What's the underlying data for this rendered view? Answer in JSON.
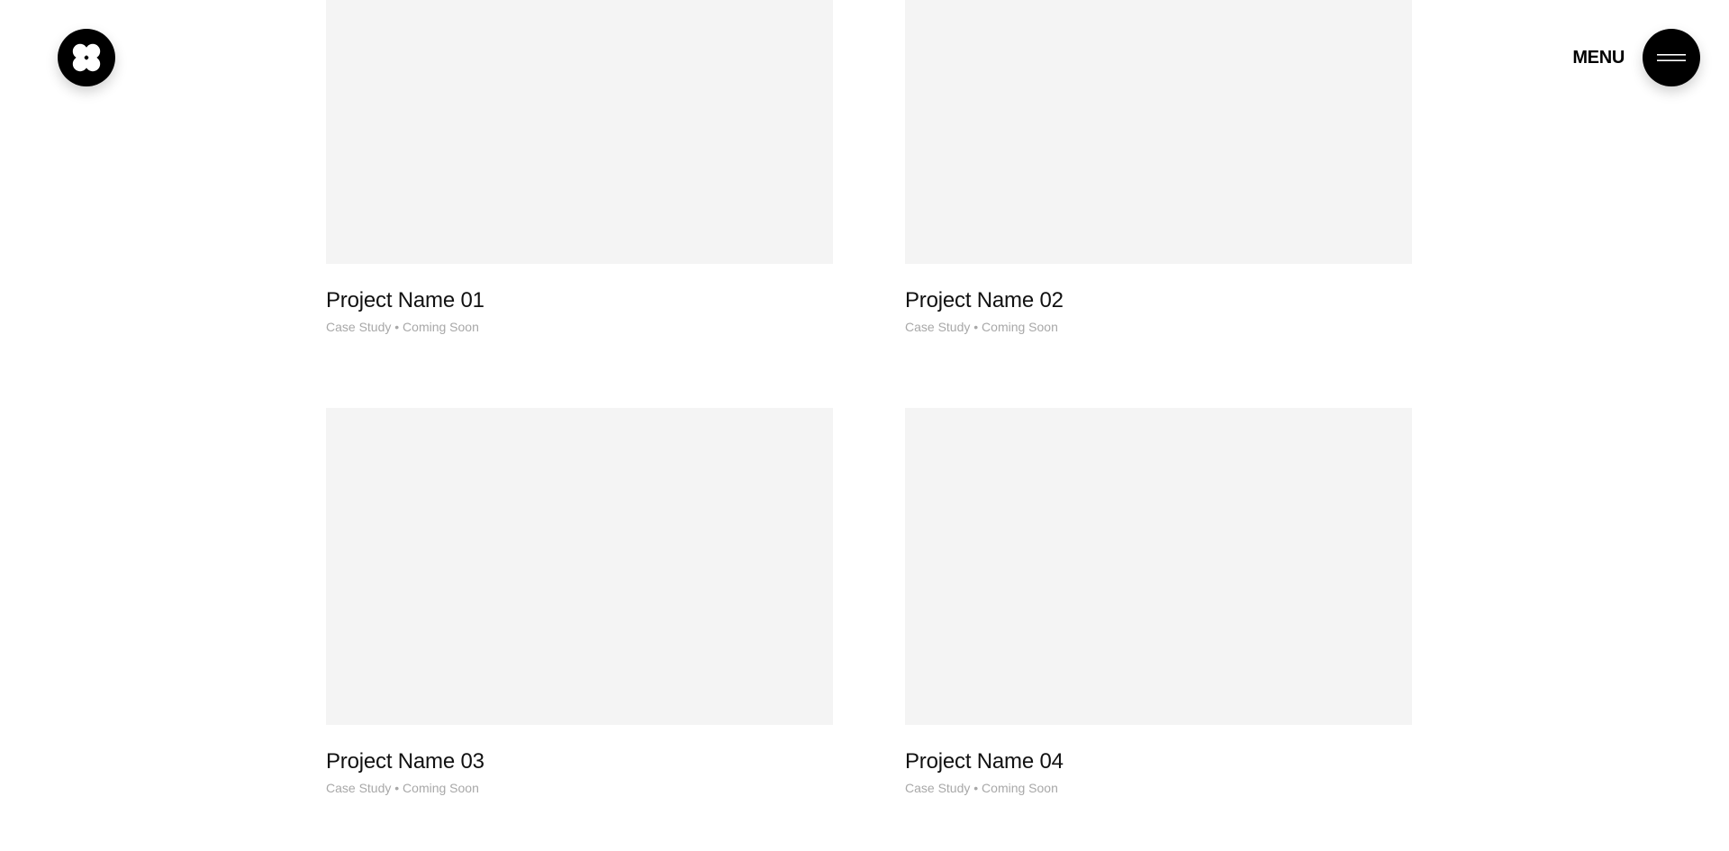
{
  "header": {
    "logo_icon": "four-petal-flower-icon",
    "menu_label": "MENU",
    "menu_icon": "hamburger-icon"
  },
  "projects": [
    {
      "title": "Project Name 01",
      "meta": "Case Study • Coming Soon"
    },
    {
      "title": "Project Name 02",
      "meta": "Case Study • Coming Soon"
    },
    {
      "title": "Project Name 03",
      "meta": "Case Study • Coming Soon"
    },
    {
      "title": "Project Name 04",
      "meta": "Case Study • Coming Soon"
    }
  ],
  "colors": {
    "background": "#ffffff",
    "button": "#000000",
    "thumbnail": "#f4f4f4",
    "meta_text": "#a8a8a8"
  }
}
